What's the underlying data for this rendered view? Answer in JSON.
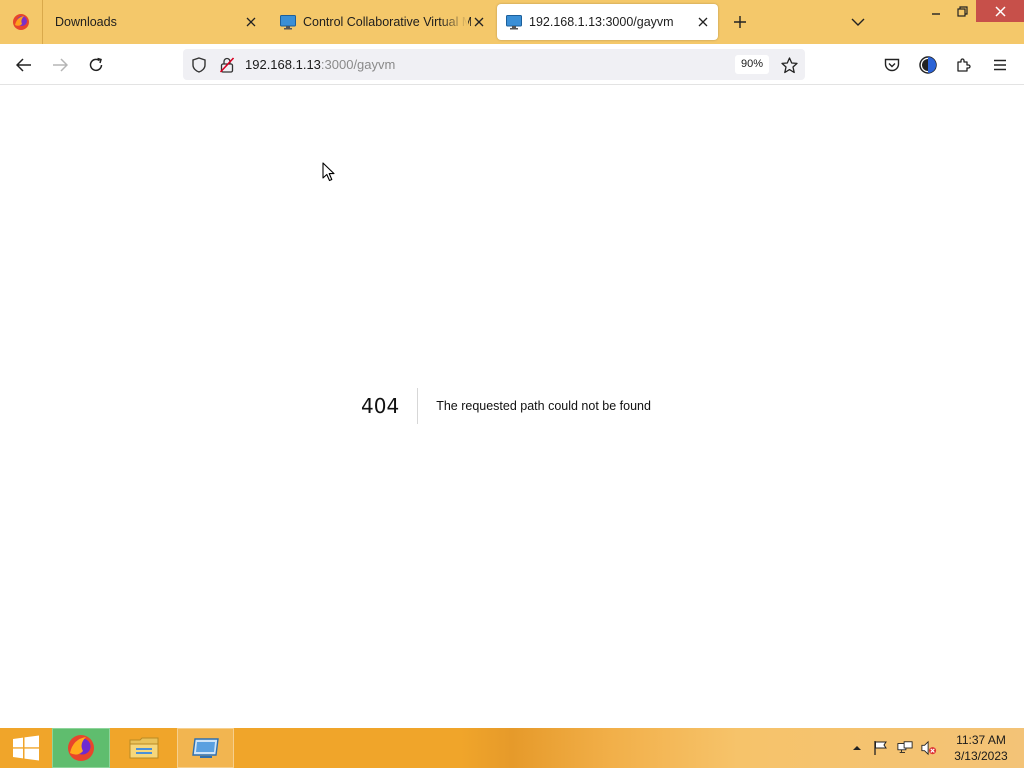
{
  "browser": {
    "tabs": [
      {
        "label": "Downloads",
        "icon": "firefox-icon",
        "active": false
      },
      {
        "label": "Control Collaborative Virtual Machine",
        "icon": "monitor-icon",
        "active": false
      },
      {
        "label": "192.168.1.13:3000/gayvm",
        "icon": "monitor-icon",
        "active": true
      }
    ],
    "url": {
      "host": "192.168.1.13",
      "path": ":3000/gayvm"
    },
    "zoom": "90%"
  },
  "page": {
    "error_code": "404",
    "error_message": "The requested path could not be found"
  },
  "taskbar": {
    "clock_time": "11:37 AM",
    "clock_date": "3/13/2023",
    "apps": [
      "firefox-icon",
      "file-explorer-icon",
      "remote-desktop-icon"
    ]
  },
  "colors": {
    "tabstrip": "#f4c86a",
    "taskbar": "#f0a52a",
    "close_button": "#c7504a",
    "firefox_taskbar_highlight": "#5fbd6e"
  }
}
